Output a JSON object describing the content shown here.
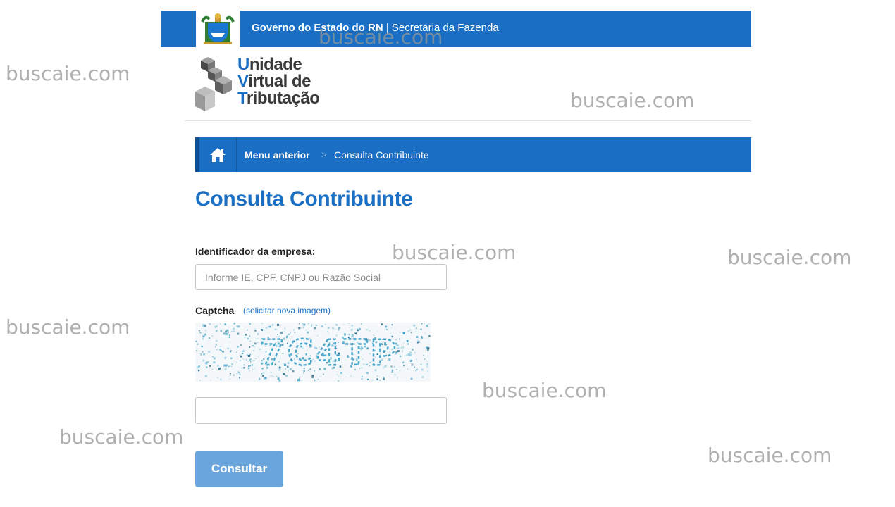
{
  "header": {
    "gov_name": "Governo do Estado do RN",
    "separator": " | ",
    "secretaria": "Secretaria da Fazenda",
    "seal_icon": "coat-of-arms-icon"
  },
  "logo": {
    "line1_cap": "U",
    "line1_rest": "nidade",
    "line2_cap": "V",
    "line2_rest": "irtual de",
    "line3_cap": "T",
    "line3_rest": "ributação",
    "icon": "stacked-cubes-icon"
  },
  "breadcrumb": {
    "home_icon": "home-icon",
    "previous": "Menu anterior",
    "separator": ">",
    "current": "Consulta Contribuinte"
  },
  "page_title": "Consulta Contribuinte",
  "form": {
    "identifier_label": "Identificador da empresa:",
    "identifier_placeholder": "Informe IE, CPF, CNPJ ou Razão Social",
    "identifier_value": "",
    "captcha_label": "Captcha",
    "captcha_refresh_link": "(solicitar nova imagem)",
    "captcha_text": "7C4TP",
    "captcha_value": "",
    "submit_label": "Consultar"
  },
  "watermark_text": "buscaie.com",
  "colors": {
    "primary": "#1a6fc4",
    "primary_dark": "#0d4f96",
    "button": "#6aa6dc"
  }
}
